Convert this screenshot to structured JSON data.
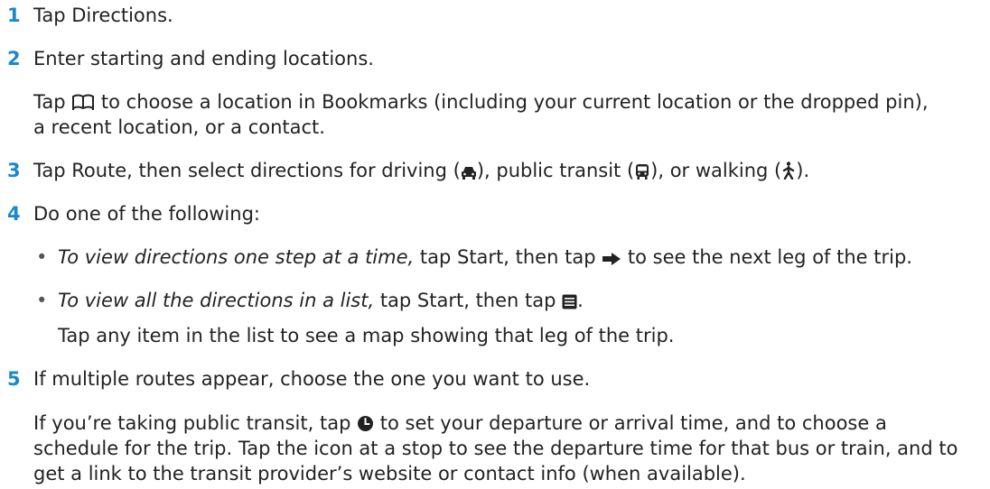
{
  "steps": [
    {
      "num": "1",
      "text": "Tap Directions."
    },
    {
      "num": "2",
      "text": "Enter starting and ending locations."
    },
    {
      "num": "3",
      "parts": [
        "Tap Route, then select directions for driving (",
        "), public transit (",
        "), or walking (",
        ")."
      ]
    },
    {
      "num": "4",
      "text": "Do one of the following:"
    },
    {
      "num": "5",
      "text": "If multiple routes appear, choose the one you want to use."
    }
  ],
  "step2_detail": {
    "line1_before": "Tap ",
    "line1_after": " to choose a location in Bookmarks (including your current location or the dropped pin),",
    "line2": "a recent location, or a contact."
  },
  "bullets": [
    {
      "italic": "To view directions one step at a time,",
      "before_icon": " tap Start, then tap ",
      "after_icon": " to see the next leg of the trip."
    },
    {
      "italic": "To view all the directions in a list,",
      "before_icon": " tap Start, then tap ",
      "after_icon": "."
    }
  ],
  "bullet2_detail": "Tap any item in the list to see a map showing that leg of the trip.",
  "transit_note": {
    "line1_before": "If you’re taking public transit, tap ",
    "line1_after": " to set your departure or arrival time, and to choose a",
    "line2": "schedule for the trip. Tap the icon at a stop to see the departure time for that bus or train, and to",
    "line3": "get a link to the transit provider’s website or contact info (when available)."
  },
  "bullet_glyph": "•",
  "icons": [
    "bookmarks-icon",
    "car-icon",
    "bus-icon",
    "walking-icon",
    "arrow-right-icon",
    "list-icon",
    "clock-icon"
  ],
  "colors": {
    "step_number": "#1a88c9",
    "text": "#222222"
  }
}
